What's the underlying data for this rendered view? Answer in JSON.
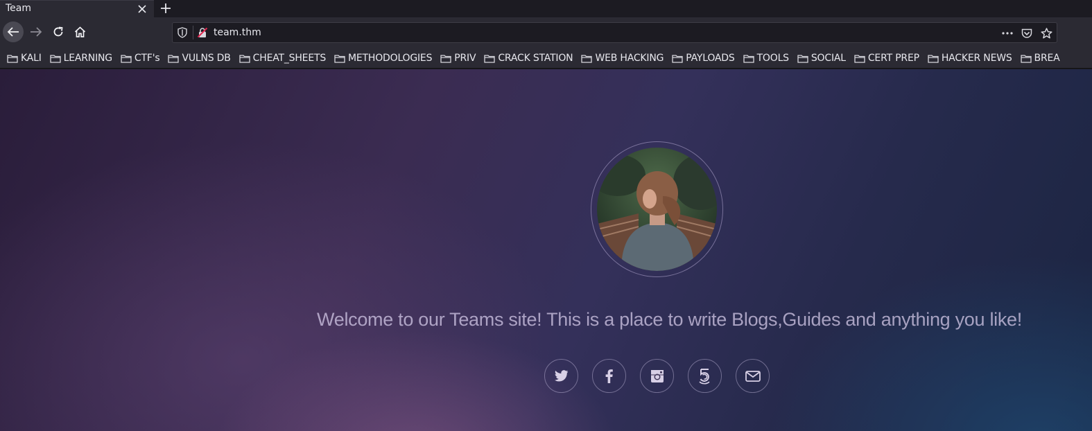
{
  "tab": {
    "title": "Team",
    "close_icon": "close-icon",
    "newtab_icon": "plus-icon"
  },
  "nav": {
    "back_icon": "arrow-left-icon",
    "forward_icon": "arrow-right-icon",
    "reload_icon": "reload-icon",
    "home_icon": "home-icon",
    "url": "team.thm",
    "shield_icon": "shield-icon",
    "insecure_icon": "insecure-lock-icon",
    "actions": [
      "more-icon",
      "pocket-icon",
      "star-icon"
    ]
  },
  "bookmarks": [
    {
      "label": "KALI"
    },
    {
      "label": "LEARNING"
    },
    {
      "label": "CTF's"
    },
    {
      "label": "VULNS DB"
    },
    {
      "label": "CHEAT_SHEETS"
    },
    {
      "label": "METHODOLOGIES"
    },
    {
      "label": "PRIV"
    },
    {
      "label": "CRACK STATION"
    },
    {
      "label": "WEB HACKING"
    },
    {
      "label": "PAYLOADS"
    },
    {
      "label": "TOOLS"
    },
    {
      "label": "SOCIAL"
    },
    {
      "label": "CERT PREP"
    },
    {
      "label": "HACKER NEWS"
    },
    {
      "label": "BREA"
    }
  ],
  "page": {
    "welcome": "Welcome to our Teams site! This is a place to write Blogs,Guides and anything you like!",
    "socials": [
      "twitter-icon",
      "facebook-icon",
      "instagram-icon",
      "500px-icon",
      "email-icon"
    ],
    "colors": {
      "text": "#cdc3e1",
      "bg_dark": "#2a1d3a",
      "bg_blue": "#1b2542"
    }
  }
}
